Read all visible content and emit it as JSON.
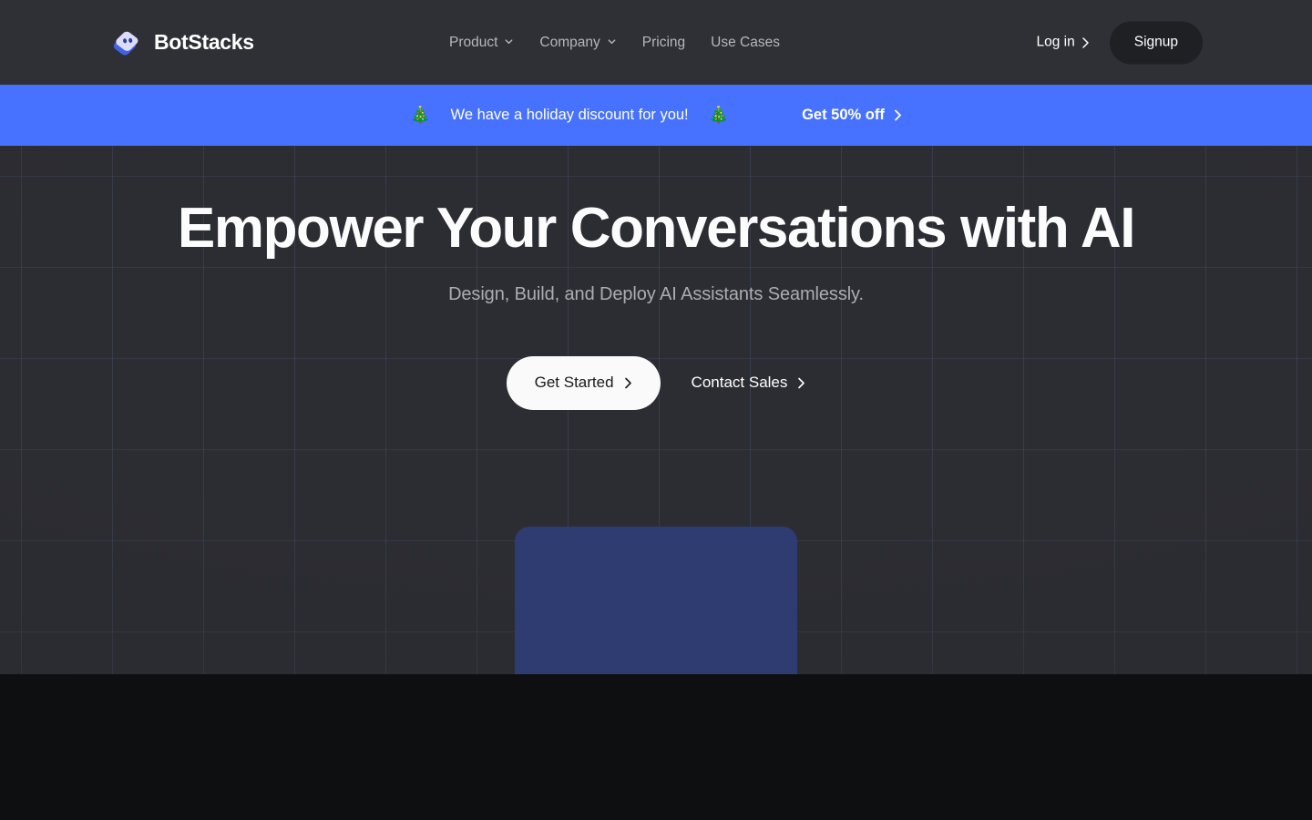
{
  "brand": {
    "name": "BotStacks",
    "logo_icon": "botstacks-logo-icon",
    "logo_front_color": "#DCDCFA",
    "logo_back_color": "#3E63E8",
    "logo_dot_color": "#2B3F9E"
  },
  "header": {
    "background_color": "#2F3036",
    "nav": [
      {
        "label": "Product",
        "has_dropdown": true,
        "icon": "chevron-down-icon"
      },
      {
        "label": "Company",
        "has_dropdown": true,
        "icon": "chevron-down-icon"
      },
      {
        "label": "Pricing",
        "has_dropdown": false,
        "icon": ""
      },
      {
        "label": "Use Cases",
        "has_dropdown": false,
        "icon": ""
      }
    ],
    "login_label": "Log in",
    "login_icon": "chevron-right-icon",
    "signup_label": "Signup"
  },
  "promo": {
    "background_color": "#4772FF",
    "emoji_left": "🎄",
    "emoji_right": "🎄",
    "message": "We have a holiday discount for you!",
    "cta_label": "Get 50% off",
    "cta_icon": "chevron-right-icon"
  },
  "hero": {
    "background_color": "#2C2D33",
    "title": "Empower Your Conversations with AI",
    "subtitle": "Design, Build, and Deploy AI Assistants Seamlessly.",
    "primary_cta": {
      "label": "Get Started",
      "icon": "chevron-right-icon"
    },
    "secondary_cta": {
      "label": "Contact Sales",
      "icon": "chevron-right-icon"
    },
    "preview_card": {
      "name": "hero-preview-card",
      "color": "#2E3C71"
    }
  },
  "lower_section": {
    "background_color": "#0E0F10"
  }
}
